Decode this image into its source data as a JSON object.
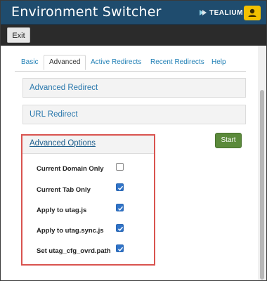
{
  "window": {
    "title": "Environment Switcher",
    "brand": "TEALIUM",
    "user_icon": "user-icon"
  },
  "toolbar": {
    "exit_label": "Exit"
  },
  "tabs": [
    {
      "label": "Basic",
      "active": false
    },
    {
      "label": "Advanced",
      "active": true
    },
    {
      "label": "Active Redirects",
      "active": false
    },
    {
      "label": "Recent Redirects",
      "active": false
    },
    {
      "label": "Help",
      "active": false
    }
  ],
  "sections": {
    "advanced_redirect": "Advanced Redirect",
    "url_redirect": "URL Redirect",
    "advanced_options": "Advanced Options"
  },
  "start_label": "Start",
  "options": [
    {
      "label": "Current Domain Only",
      "checked": false
    },
    {
      "label": "Current Tab Only",
      "checked": true
    },
    {
      "label": "Apply to utag.js",
      "checked": true
    },
    {
      "label": "Apply to utag.sync.js",
      "checked": true
    },
    {
      "label": "Set utag_cfg_ovrd.path",
      "checked": true
    }
  ],
  "colors": {
    "titlebar": "#1f4c6e",
    "highlight_border": "#d9534f",
    "start_button": "#5b8a3b",
    "checkbox_checked": "#2f73c8",
    "link": "#2a78ad"
  }
}
